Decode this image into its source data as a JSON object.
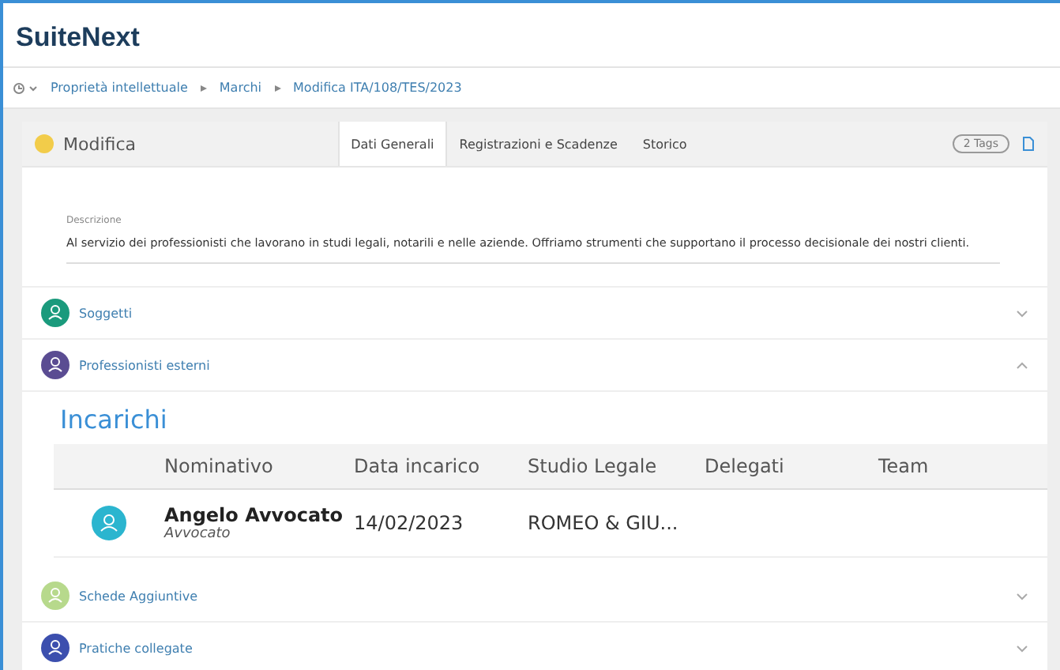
{
  "app": {
    "title": "SuiteNext"
  },
  "breadcrumb": [
    "Proprietà intellettuale",
    "Marchi",
    "Modifica ITA/108/TES/2023"
  ],
  "card": {
    "title": "Modifica",
    "tags": "2 Tags",
    "tabs": [
      {
        "label": "Dati Generali",
        "selected": true
      },
      {
        "label": "Registrazioni e Scadenze",
        "selected": false
      },
      {
        "label": "Storico",
        "selected": false
      }
    ]
  },
  "description": {
    "label": "Descrizione",
    "value": "Al servizio dei professionisti che lavorano in studi legali, notarili e nelle aziende. Offriamo strumenti che supportano il processo decisionale dei nostri clienti."
  },
  "sections": [
    {
      "title": "Soggetti",
      "color": "#1a9a7c",
      "expanded": false
    },
    {
      "title": "Professionisti esterni",
      "color": "#5a4c92",
      "expanded": true,
      "content": {
        "heading": "Incarichi",
        "columns": [
          "Nominativo",
          "Data incarico",
          "Studio Legale",
          "Delegati",
          "Team"
        ],
        "rows": [
          {
            "name": "Angelo Avvocato",
            "role": "Avvocato",
            "date": "14/02/2023",
            "studio": "ROMEO & GIU..."
          }
        ]
      }
    },
    {
      "title": "Schede Aggiuntive",
      "color": "#b7d98c",
      "expanded": false
    },
    {
      "title": "Pratiche collegate",
      "color": "#3c4fae",
      "expanded": false
    }
  ]
}
